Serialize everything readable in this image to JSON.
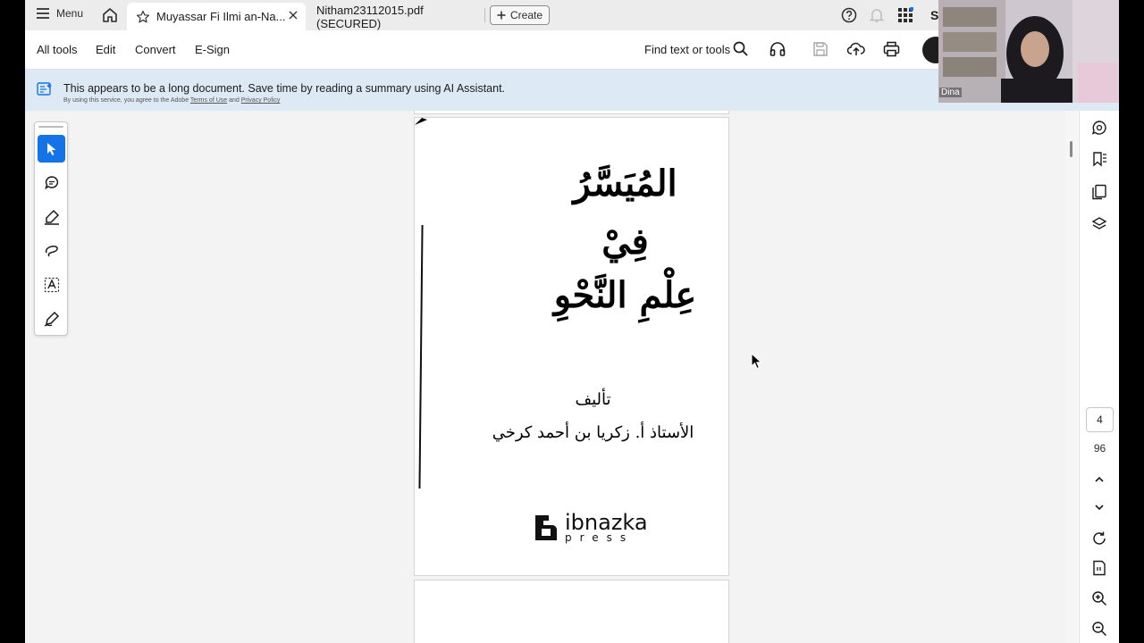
{
  "tabbar": {
    "menu_label": "Menu",
    "active_tab_title": "Muyassar Fi Ilmi an-Na...",
    "second_tab_title": "Nitham23112015.pdf (SECURED)",
    "create_label": "Create",
    "user_initial": "S"
  },
  "toolbar": {
    "menus": [
      "All tools",
      "Edit",
      "Convert",
      "E-Sign"
    ],
    "find_label": "Find text or tools"
  },
  "banner": {
    "message": "This appears to be a long document. Save time by reading a summary using AI Assistant.",
    "sub_prefix": "By using this service, you agree to the Adobe",
    "terms_link": "Terms of Use",
    "and": "and",
    "privacy_link": "Privacy Policy"
  },
  "document": {
    "title_line1": "المُيَسَّرُ",
    "title_line2": "فِيْ",
    "title_line3": "عِلْمِ النَّحْوِ",
    "author_label": "تأليف",
    "author_name": "الأستاذ أ. زكريا بن أحمد كرخي",
    "publisher_main": "ibnazka",
    "publisher_sub": "press"
  },
  "navigation": {
    "current_page": "4",
    "total_pages": "96"
  },
  "webcam": {
    "participant_name": "Dina"
  },
  "colors": {
    "accent": "#1473e6",
    "banner_bg": "#dde9f5",
    "tab_bar_bg": "#ececec"
  }
}
